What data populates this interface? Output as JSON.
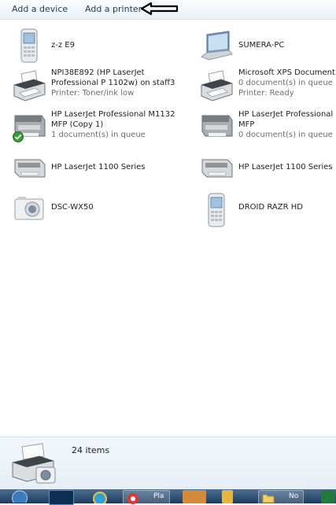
{
  "toolbar": {
    "add_device": "Add a device",
    "add_printer": "Add a printer"
  },
  "devices": [
    {
      "name": "z-z E9",
      "lines": []
    },
    {
      "name": "SUMERA-PC",
      "lines": []
    },
    {
      "name": "NPI38E892 (HP LaserJet",
      "lines": [
        "Professional P 1102w) on staff3",
        "Printer:  Toner/ink low"
      ]
    },
    {
      "name": "Microsoft XPS Document",
      "lines": [
        "0 document(s) in queue",
        "Printer:  Ready"
      ]
    },
    {
      "name": "HP LaserJet Professional M1132",
      "lines": [
        "MFP (Copy 1)",
        "1 document(s) in queue"
      ]
    },
    {
      "name": "HP LaserJet Professional M",
      "lines": [
        "MFP",
        "0 document(s) in queue"
      ]
    },
    {
      "name": "HP LaserJet 1100 Series",
      "lines": []
    },
    {
      "name": "HP LaserJet 1100 Series",
      "lines": []
    },
    {
      "name": "DSC-WX50",
      "lines": []
    },
    {
      "name": "DROID RAZR HD",
      "lines": []
    }
  ],
  "details": {
    "item_count": "24 items"
  },
  "taskbar": {
    "items": [
      {
        "icon": "start-orb-icon"
      },
      {
        "icon": "photoshop-icon"
      },
      {
        "icon": "media-icon"
      },
      {
        "icon": "chrome-icon",
        "label": "Pla"
      },
      {
        "icon": "image-icon"
      },
      {
        "icon": "tool-icon"
      },
      {
        "icon": "folder-icon",
        "label": "No"
      },
      {
        "icon": "excel-icon"
      }
    ]
  }
}
